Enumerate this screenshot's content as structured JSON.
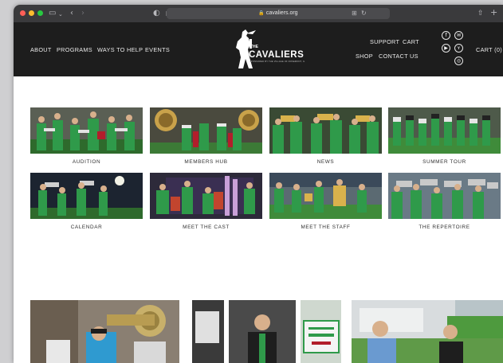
{
  "browser": {
    "url": "cavaliers.org"
  },
  "header": {
    "nav_left": [
      "ABOUT",
      "PROGRAMS",
      "WAYS TO HELP",
      "EVENTS"
    ],
    "nav_right_top": [
      "SUPPORT",
      "CART"
    ],
    "nav_right_bottom": [
      "SHOP",
      "CONTACT US"
    ],
    "cart_label": "CART (0)",
    "logo": {
      "the": "THE",
      "name": "CAVALIERS",
      "subtitle": "SPONSORED BY THE VILLAGE OF ROSEMONT, IL"
    },
    "social_icons": [
      "facebook-icon",
      "email-icon",
      "youtube-icon",
      "twitter-icon",
      "instagram-icon"
    ]
  },
  "tiles": [
    {
      "label": "AUDITION"
    },
    {
      "label": "MEMBERS HUB"
    },
    {
      "label": "NEWS"
    },
    {
      "label": "SUMMER TOUR"
    },
    {
      "label": "CALENDAR"
    },
    {
      "label": "MEET THE CAST"
    },
    {
      "label": "MEET THE STAFF"
    },
    {
      "label": "THE REPERTOIRE"
    }
  ],
  "colors": {
    "header_bg": "#1d1d1d",
    "uniform_green": "#2f9a4a",
    "field_green": "#3f8b3a"
  }
}
